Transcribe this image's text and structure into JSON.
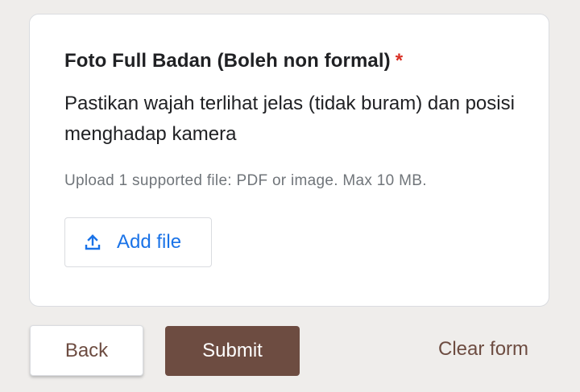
{
  "question": {
    "title": "Foto Full Badan (Boleh non formal)",
    "required_marker": "*",
    "description": "Pastikan wajah terlihat jelas (tidak buram) dan posisi menghadap kamera",
    "upload_hint": "Upload 1 supported file: PDF or image. Max 10 MB.",
    "add_file_label": "Add file",
    "add_file_icon": "upload-icon"
  },
  "footer": {
    "back_label": "Back",
    "submit_label": "Submit",
    "clear_label": "Clear form"
  },
  "colors": {
    "page_background": "#efedeb",
    "theme_accent": "#6d4c41",
    "required": "#d93025",
    "link_blue": "#1a73e8"
  }
}
